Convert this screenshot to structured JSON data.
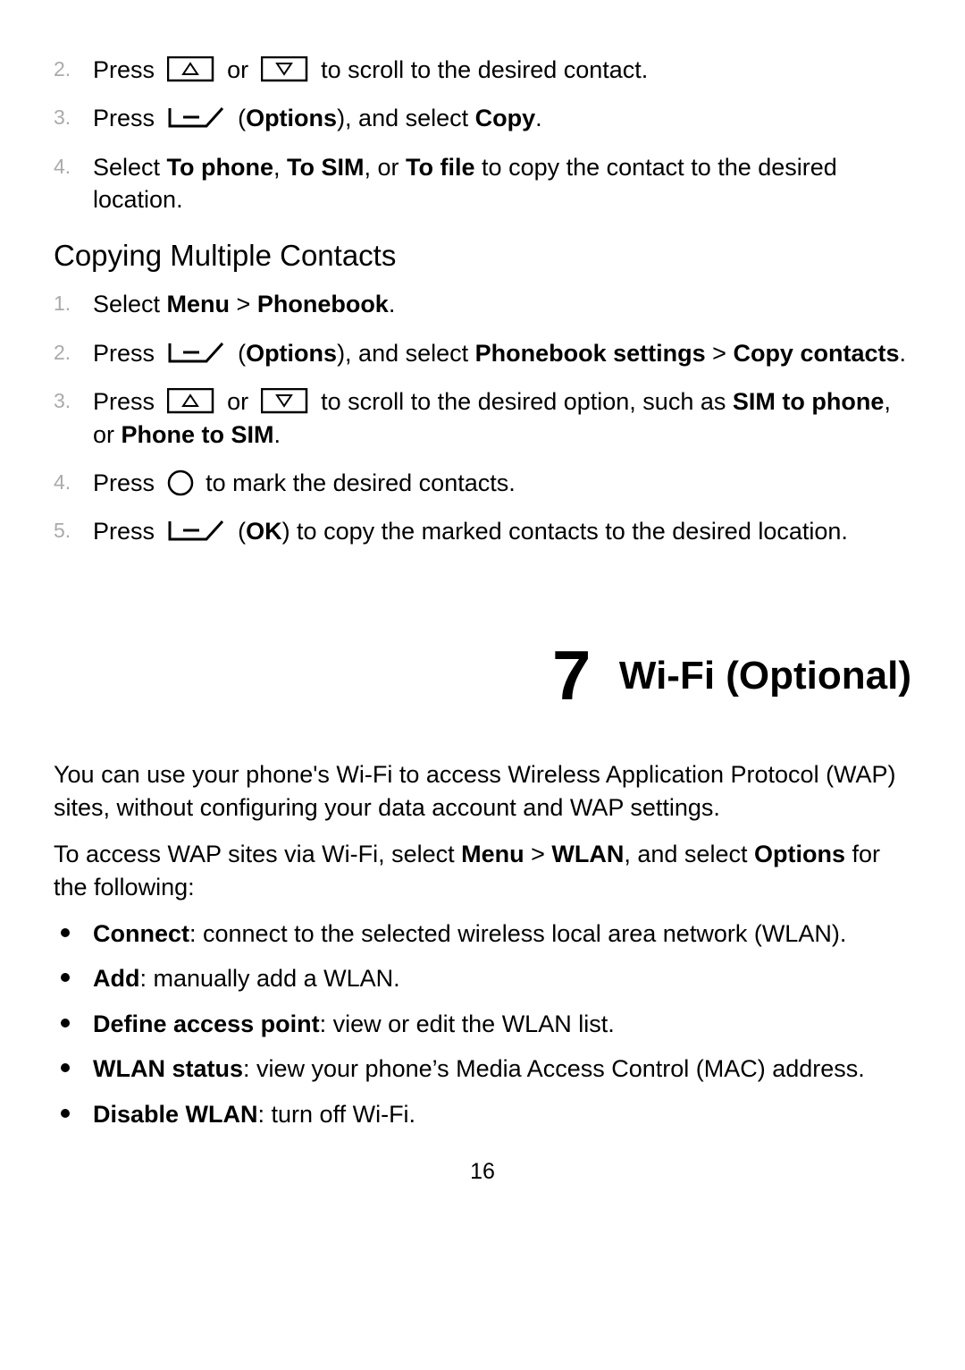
{
  "step2": {
    "press": "Press",
    "or": "or",
    "tail": "to scroll to the desired contact."
  },
  "step3": {
    "press": "Press",
    "spaceParen": " (",
    "options": "Options",
    "pAndSelect": "), and select ",
    "copy": "Copy",
    "dot": "."
  },
  "step4": {
    "select": "Select ",
    "toPhone": "To phone",
    "comma1": ", ",
    "toSIM": "To SIM",
    "commaOr": ", or ",
    "toFile": "To file",
    "tail": " to copy the contact to the desired location."
  },
  "subhead": "Copying Multiple Contacts",
  "m1": {
    "select": "Select ",
    "menu": "Menu",
    "gt": " > ",
    "phonebook": "Phonebook",
    "dot": "."
  },
  "m2": {
    "press": "Press",
    "spaceParen": " (",
    "options": "Options",
    "pAndSelect": "), and select ",
    "pbs": "Phonebook settings",
    "gt": " > ",
    "copyContacts1": "Copy",
    "copyContacts2": "contacts",
    "dot": "."
  },
  "m3": {
    "press": "Press",
    "or": "or",
    "mid": "to scroll to the desired option, such as ",
    "simToPhone1": "SIM",
    "simToPhone2": "to phone",
    "commaOr": ", or ",
    "phoneToSIM": "Phone to SIM",
    "dot": "."
  },
  "m4": {
    "press": "Press",
    "tail": "to mark the desired contacts."
  },
  "m5": {
    "press": "Press",
    "spaceParen": " (",
    "ok": "OK",
    "tail": ") to copy the marked contacts to the desired location."
  },
  "chapter": {
    "num": "7",
    "title": "Wi-Fi (Optional)"
  },
  "p1": "You can use your phone's Wi-Fi to access Wireless Application Protocol (WAP) sites, without configuring your data account and WAP settings.",
  "p2a": "To access WAP sites via Wi-Fi, select ",
  "p2menu": "Menu",
  "p2gt": " > ",
  "p2wlan": "WLAN",
  "p2mid": ", and select ",
  "p2options": "Options",
  "p2tail": " for the following:",
  "b1": {
    "bold": "Connect",
    "tail": ": connect to the selected wireless local area network (WLAN)."
  },
  "b2": {
    "bold": "Add",
    "tail": ": manually add a WLAN."
  },
  "b3": {
    "bold": "Define access point",
    "tail": ": view or edit the WLAN list."
  },
  "b4": {
    "bold": "WLAN status",
    "tail": ": view your phone’s Media Access Control (MAC) address."
  },
  "b5": {
    "bold": "Disable WLAN",
    "tail": ": turn off Wi-Fi."
  },
  "pageNumber": "16"
}
